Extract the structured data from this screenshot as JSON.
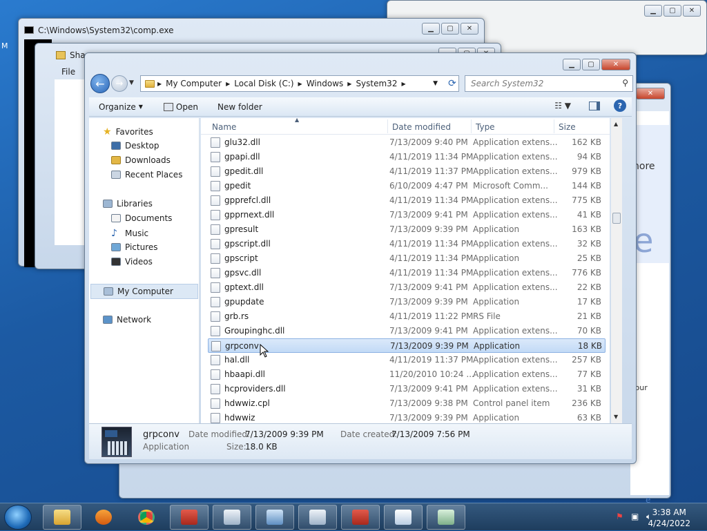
{
  "background_windows": {
    "cmd_title": "C:\\Windows\\System32\\comp.exe",
    "share_title": "Sha",
    "file_menu": "File",
    "right_fragment_1": "nore",
    "right_fragment_2": "e",
    "right_fragment_3": "your",
    "right_fragment_4": "e"
  },
  "explorer": {
    "breadcrumb": [
      "My Computer",
      "Local Disk (C:)",
      "Windows",
      "System32"
    ],
    "search_placeholder": "Search System32",
    "toolbar": {
      "organize": "Organize",
      "open": "Open",
      "new_folder": "New folder"
    },
    "sidebar": {
      "favorites": "Favorites",
      "desktop": "Desktop",
      "downloads": "Downloads",
      "recent_places": "Recent Places",
      "libraries": "Libraries",
      "documents": "Documents",
      "music": "Music",
      "pictures": "Pictures",
      "videos": "Videos",
      "my_computer": "My Computer",
      "network": "Network"
    },
    "columns": {
      "name": "Name",
      "date_modified": "Date modified",
      "type": "Type",
      "size": "Size"
    },
    "files": [
      {
        "name": "glu32.dll",
        "date": "7/13/2009 9:40 PM",
        "type": "Application extens...",
        "size": "162 KB"
      },
      {
        "name": "gpapi.dll",
        "date": "4/11/2019 11:34 PM",
        "type": "Application extens...",
        "size": "94 KB"
      },
      {
        "name": "gpedit.dll",
        "date": "4/11/2019 11:37 PM",
        "type": "Application extens...",
        "size": "979 KB"
      },
      {
        "name": "gpedit",
        "date": "6/10/2009 4:47 PM",
        "type": "Microsoft Comm...",
        "size": "144 KB"
      },
      {
        "name": "gpprefcl.dll",
        "date": "4/11/2019 11:34 PM",
        "type": "Application extens...",
        "size": "775 KB"
      },
      {
        "name": "gpprnext.dll",
        "date": "7/13/2009 9:41 PM",
        "type": "Application extens...",
        "size": "41 KB"
      },
      {
        "name": "gpresult",
        "date": "7/13/2009 9:39 PM",
        "type": "Application",
        "size": "163 KB"
      },
      {
        "name": "gpscript.dll",
        "date": "4/11/2019 11:34 PM",
        "type": "Application extens...",
        "size": "32 KB"
      },
      {
        "name": "gpscript",
        "date": "4/11/2019 11:34 PM",
        "type": "Application",
        "size": "25 KB"
      },
      {
        "name": "gpsvc.dll",
        "date": "4/11/2019 11:34 PM",
        "type": "Application extens...",
        "size": "776 KB"
      },
      {
        "name": "gptext.dll",
        "date": "7/13/2009 9:41 PM",
        "type": "Application extens...",
        "size": "22 KB"
      },
      {
        "name": "gpupdate",
        "date": "7/13/2009 9:39 PM",
        "type": "Application",
        "size": "17 KB"
      },
      {
        "name": "grb.rs",
        "date": "4/11/2019 11:22 PM",
        "type": "RS File",
        "size": "21 KB"
      },
      {
        "name": "Groupinghc.dll",
        "date": "7/13/2009 9:41 PM",
        "type": "Application extens...",
        "size": "70 KB"
      },
      {
        "name": "grpconv",
        "date": "7/13/2009 9:39 PM",
        "type": "Application",
        "size": "18 KB",
        "selected": true
      },
      {
        "name": "hal.dll",
        "date": "4/11/2019 11:37 PM",
        "type": "Application extens...",
        "size": "257 KB"
      },
      {
        "name": "hbaapi.dll",
        "date": "11/20/2010 10:24 ...",
        "type": "Application extens...",
        "size": "77 KB"
      },
      {
        "name": "hcproviders.dll",
        "date": "7/13/2009 9:41 PM",
        "type": "Application extens...",
        "size": "31 KB"
      },
      {
        "name": "hdwwiz.cpl",
        "date": "7/13/2009 9:38 PM",
        "type": "Control panel item",
        "size": "236 KB"
      },
      {
        "name": "hdwwiz",
        "date": "7/13/2009 9:39 PM",
        "type": "Application",
        "size": "63 KB"
      }
    ],
    "details": {
      "name": "grpconv",
      "type": "Application",
      "date_modified_label": "Date modified:",
      "date_modified": "7/13/2009 9:39 PM",
      "date_created_label": "Date created:",
      "date_created": "7/13/2009 7:56 PM",
      "size_label": "Size:",
      "size": "18.0 KB"
    }
  },
  "taskbar": {
    "time": "3:38 AM",
    "date": "4/24/2022"
  }
}
